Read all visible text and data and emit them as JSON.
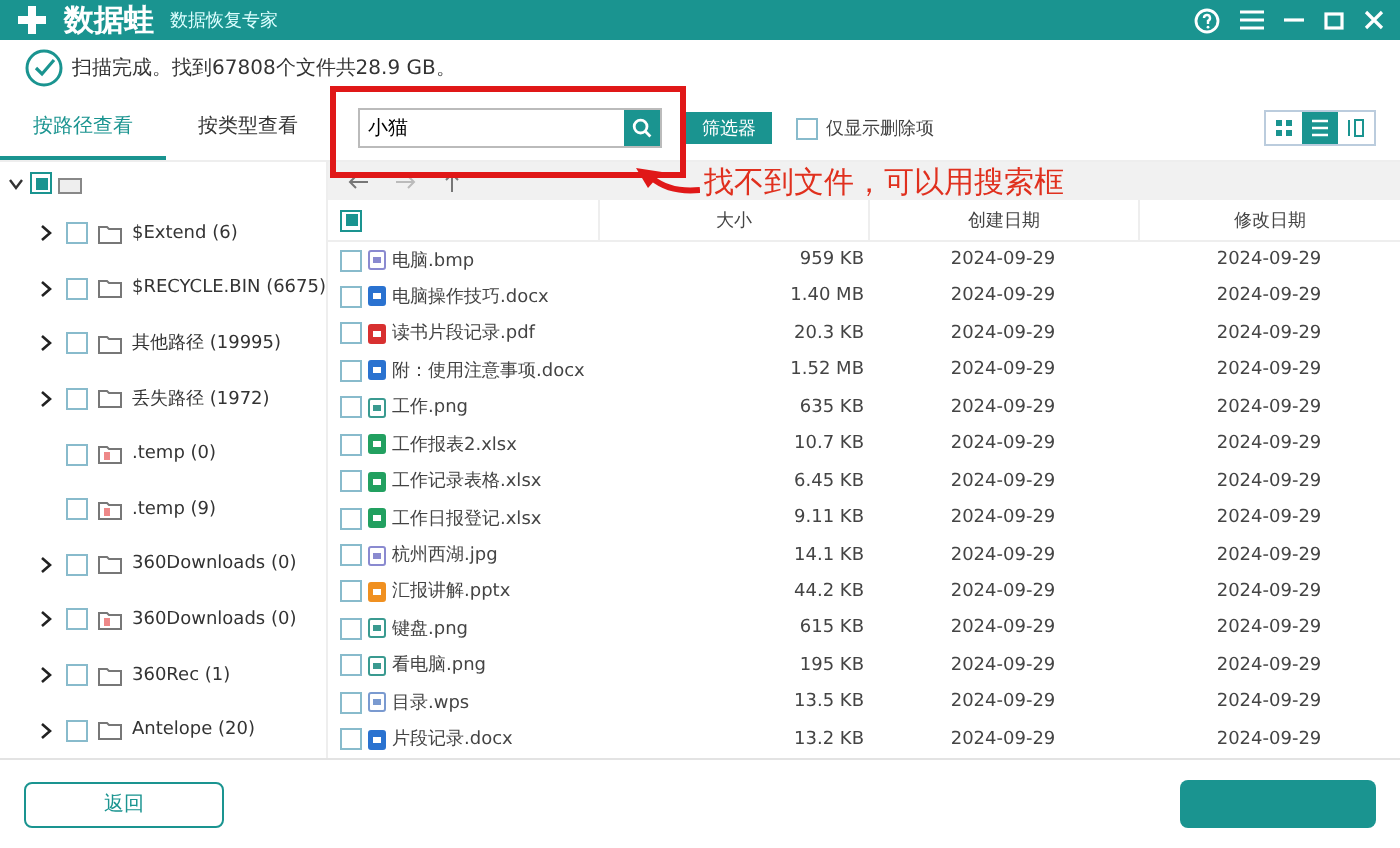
{
  "app": {
    "name": "数据蛙",
    "subtitle": "数据恢复专家"
  },
  "status": "扫描完成。找到67808个文件共28.9 GB。",
  "tabs": [
    {
      "label": "按路径查看",
      "selected": true
    },
    {
      "label": "按类型查看",
      "selected": false
    }
  ],
  "search": {
    "value": "小猫"
  },
  "filter_button": "筛选器",
  "deleted_only": {
    "label": "仅显示删除项",
    "checked": false
  },
  "views": [
    {
      "kind": "grid",
      "selected": false
    },
    {
      "kind": "list",
      "selected": true
    },
    {
      "kind": "detail",
      "selected": false
    }
  ],
  "tree": {
    "root": {
      "checked": true,
      "expanded": true
    },
    "items": [
      {
        "label": "$Extend (6)",
        "expandable": true,
        "checked": false,
        "kind": "folder"
      },
      {
        "label": "$RECYCLE.BIN (6675)",
        "expandable": true,
        "checked": false,
        "kind": "folder"
      },
      {
        "label": "其他路径 (19995)",
        "expandable": true,
        "checked": false,
        "kind": "folder"
      },
      {
        "label": "丢失路径 (1972)",
        "expandable": true,
        "checked": false,
        "kind": "folder"
      },
      {
        "label": ".temp (0)",
        "expandable": false,
        "checked": false,
        "kind": "marked"
      },
      {
        "label": ".temp (9)",
        "expandable": false,
        "checked": false,
        "kind": "marked"
      },
      {
        "label": "360Downloads (0)",
        "expandable": true,
        "checked": false,
        "kind": "folder"
      },
      {
        "label": "360Downloads (0)",
        "expandable": true,
        "checked": false,
        "kind": "marked"
      },
      {
        "label": "360Rec (1)",
        "expandable": true,
        "checked": false,
        "kind": "folder"
      },
      {
        "label": "Antelope (20)",
        "expandable": true,
        "checked": false,
        "kind": "folder"
      }
    ]
  },
  "table": {
    "columns": [
      "大小",
      "创建日期",
      "修改日期"
    ],
    "select_all": true,
    "rows": [
      {
        "name": "电脑.bmp",
        "kind": "image",
        "checked": false,
        "size": "959 KB",
        "created": "2024-09-29",
        "modified": "2024-09-29"
      },
      {
        "name": "电脑操作技巧.docx",
        "kind": "doc",
        "checked": false,
        "size": "1.40 MB",
        "created": "2024-09-29",
        "modified": "2024-09-29"
      },
      {
        "name": "读书片段记录.pdf",
        "kind": "pdf",
        "checked": false,
        "size": "20.3 KB",
        "created": "2024-09-29",
        "modified": "2024-09-29"
      },
      {
        "name": "附：使用注意事项.docx",
        "kind": "doc",
        "checked": false,
        "size": "1.52 MB",
        "created": "2024-09-29",
        "modified": "2024-09-29"
      },
      {
        "name": "工作.png",
        "kind": "png",
        "checked": false,
        "size": "635 KB",
        "created": "2024-09-29",
        "modified": "2024-09-29"
      },
      {
        "name": "工作报表2.xlsx",
        "kind": "sheet",
        "checked": false,
        "size": "10.7 KB",
        "created": "2024-09-29",
        "modified": "2024-09-29"
      },
      {
        "name": "工作记录表格.xlsx",
        "kind": "sheet",
        "checked": false,
        "size": "6.45 KB",
        "created": "2024-09-29",
        "modified": "2024-09-29"
      },
      {
        "name": "工作日报登记.xlsx",
        "kind": "sheet",
        "checked": false,
        "size": "9.11 KB",
        "created": "2024-09-29",
        "modified": "2024-09-29"
      },
      {
        "name": "杭州西湖.jpg",
        "kind": "image",
        "checked": false,
        "size": "14.1 KB",
        "created": "2024-09-29",
        "modified": "2024-09-29"
      },
      {
        "name": "汇报讲解.pptx",
        "kind": "slides",
        "checked": false,
        "size": "44.2 KB",
        "created": "2024-09-29",
        "modified": "2024-09-29"
      },
      {
        "name": "键盘.png",
        "kind": "png",
        "checked": false,
        "size": "615 KB",
        "created": "2024-09-29",
        "modified": "2024-09-29"
      },
      {
        "name": "看电脑.png",
        "kind": "png",
        "checked": false,
        "size": "195 KB",
        "created": "2024-09-29",
        "modified": "2024-09-29"
      },
      {
        "name": "目录.wps",
        "kind": "text",
        "checked": false,
        "size": "13.5 KB",
        "created": "2024-09-29",
        "modified": "2024-09-29"
      },
      {
        "name": "片段记录.docx",
        "kind": "doc",
        "checked": false,
        "size": "13.2 KB",
        "created": "2024-09-29",
        "modified": "2024-09-29"
      }
    ]
  },
  "back_button": "返回",
  "annotation": {
    "text": "找不到文件，可以用搜索框"
  }
}
